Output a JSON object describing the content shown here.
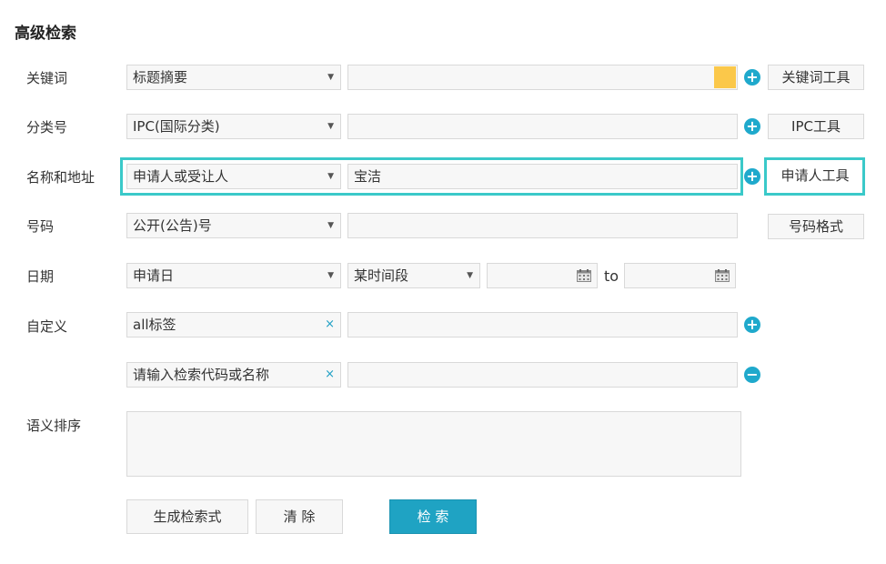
{
  "page": {
    "title": "高级检索"
  },
  "rows": {
    "keyword": {
      "label": "关键词",
      "select": "标题摘要",
      "value": "",
      "tool": "关键词工具"
    },
    "classification": {
      "label": "分类号",
      "select": "IPC(国际分类)",
      "value": "",
      "tool": "IPC工具"
    },
    "name_address": {
      "label": "名称和地址",
      "select": "申请人或受让人",
      "value": "宝洁",
      "tool": "申请人工具"
    },
    "number": {
      "label": "号码",
      "select": "公开(公告)号",
      "value": "",
      "tool": "号码格式"
    },
    "date": {
      "label": "日期",
      "select": "申请日",
      "range_select": "某时间段",
      "from": "",
      "to_text": "to",
      "to": ""
    },
    "custom": {
      "label": "自定义",
      "tag1": "all标签",
      "tag2_placeholder": "请输入检索代码或名称",
      "clear_mark": "×"
    },
    "semantic": {
      "label": "语义排序",
      "value": ""
    }
  },
  "icons": {
    "add": "+",
    "remove": "−",
    "dropdown": "▼"
  },
  "buttons": {
    "generate": "生成检索式",
    "clear": "清 除",
    "search": "检 索"
  },
  "colors": {
    "accent": "#1fa3c3",
    "highlight": "#3ac9c9",
    "marker": "#fbc84a"
  }
}
